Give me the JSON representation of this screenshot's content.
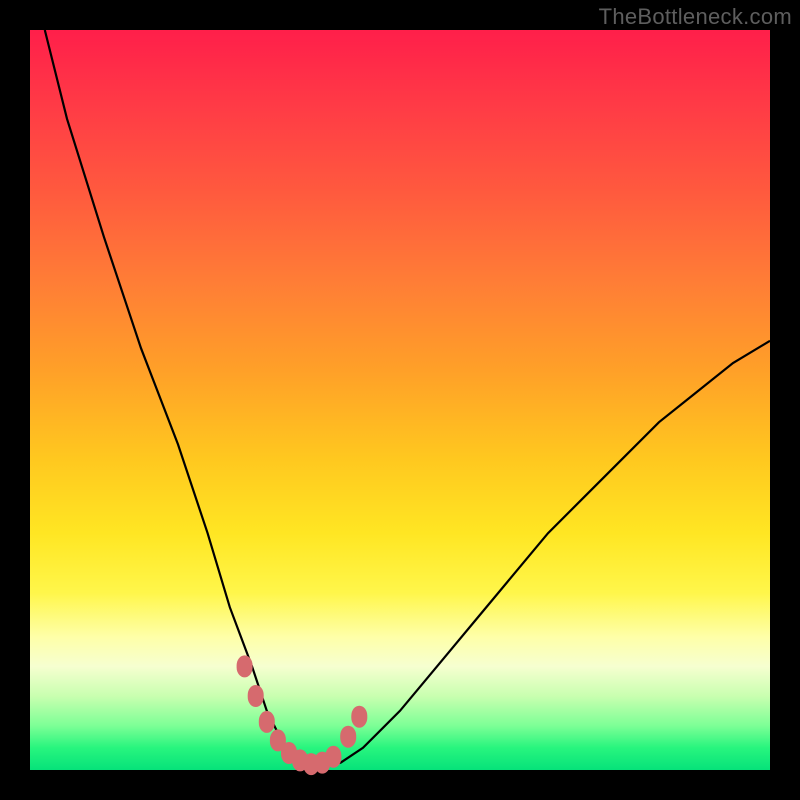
{
  "watermark": "TheBottleneck.com",
  "chart_data": {
    "type": "line",
    "title": "",
    "xlabel": "",
    "ylabel": "",
    "xlim": [
      0,
      100
    ],
    "ylim": [
      0,
      100
    ],
    "series": [
      {
        "name": "bottleneck-curve",
        "x": [
          2,
          5,
          10,
          15,
          20,
          24,
          27,
          30,
          32,
          34,
          36,
          38,
          40,
          42,
          45,
          50,
          55,
          60,
          65,
          70,
          75,
          80,
          85,
          90,
          95,
          100
        ],
        "values": [
          100,
          88,
          72,
          57,
          44,
          32,
          22,
          14,
          8,
          4,
          2,
          1,
          0.5,
          1,
          3,
          8,
          14,
          20,
          26,
          32,
          37,
          42,
          47,
          51,
          55,
          58
        ]
      }
    ],
    "highlight_points": {
      "name": "highlighted-samples",
      "color": "#d66a6e",
      "x": [
        29,
        30.5,
        32,
        33.5,
        35,
        36.5,
        38,
        39.5,
        41,
        43,
        44.5
      ],
      "values": [
        14,
        10,
        6.5,
        4,
        2.3,
        1.3,
        0.8,
        1.0,
        1.8,
        4.5,
        7.2
      ]
    },
    "gradient_stops": [
      {
        "offset": 0,
        "color": "#ff1f4a"
      },
      {
        "offset": 10,
        "color": "#ff3a46"
      },
      {
        "offset": 22,
        "color": "#ff5a3e"
      },
      {
        "offset": 34,
        "color": "#ff7d36"
      },
      {
        "offset": 46,
        "color": "#ffa028"
      },
      {
        "offset": 58,
        "color": "#ffc81f"
      },
      {
        "offset": 68,
        "color": "#ffe623"
      },
      {
        "offset": 76,
        "color": "#fff64a"
      },
      {
        "offset": 82,
        "color": "#feffa8"
      },
      {
        "offset": 86,
        "color": "#f6ffd0"
      },
      {
        "offset": 90,
        "color": "#c9ffb0"
      },
      {
        "offset": 94,
        "color": "#7dff96"
      },
      {
        "offset": 97,
        "color": "#28f57e"
      },
      {
        "offset": 100,
        "color": "#06e27a"
      }
    ]
  }
}
